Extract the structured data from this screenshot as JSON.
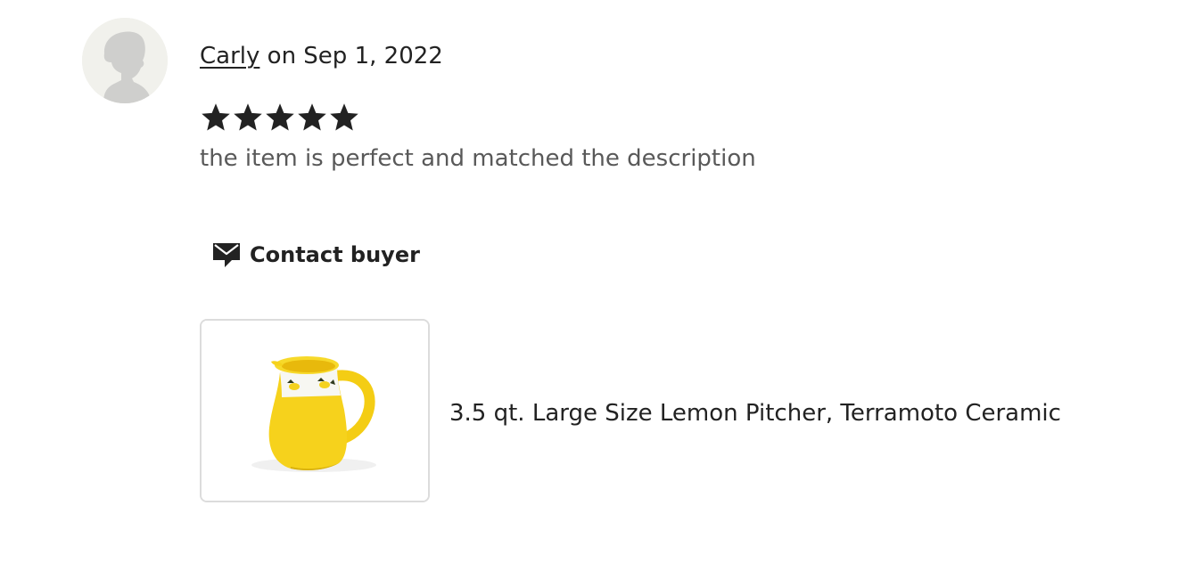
{
  "review": {
    "reviewer_name": "Carly",
    "date_text": "on Sep 1, 2022",
    "rating": 5,
    "rating_max": 5,
    "text": "the item is perfect and matched the description",
    "contact_button_label": "Contact buyer",
    "avatar_icon": "default-user-silhouette-icon",
    "contact_icon": "message-envelope-icon"
  },
  "listing": {
    "title": "3.5 qt. Large Size Lemon Pitcher, Terramoto Ceramic",
    "image_subject": "yellow ceramic pitcher with lemon pattern"
  },
  "colors": {
    "text_primary": "#222222",
    "text_secondary": "#595959",
    "star": "#222222",
    "avatar_bg": "#f1f1ec",
    "avatar_figure": "#cfcfcd",
    "border": "#dcdcdc",
    "pitcher_yellow": "#f6d21c"
  }
}
